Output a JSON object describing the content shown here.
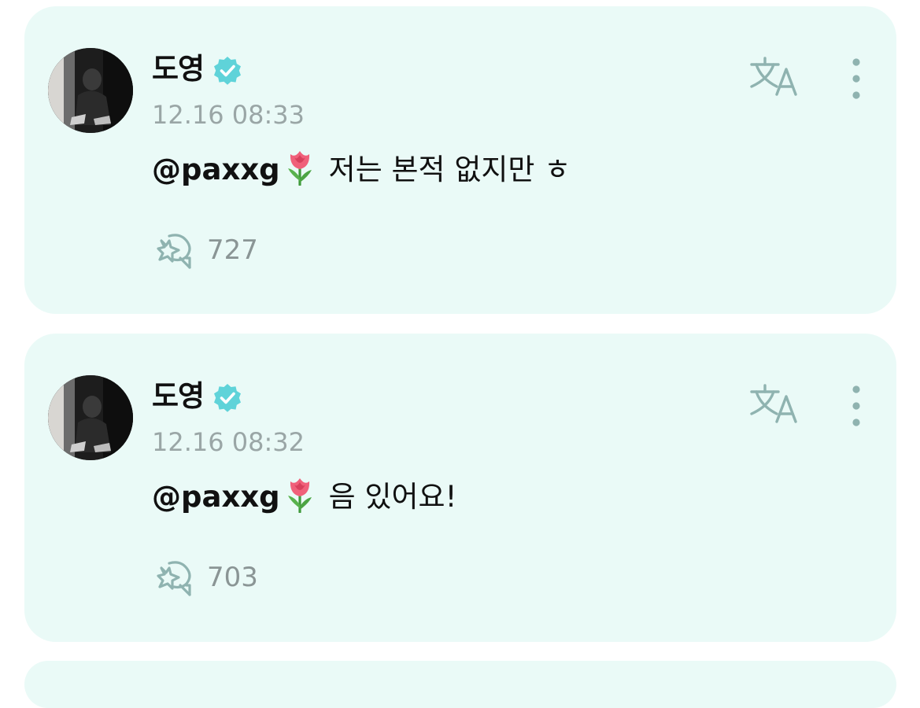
{
  "comments": [
    {
      "author": "도영",
      "timestamp": "12.16 08:33",
      "mention": "@paxxg",
      "text": "저는 본적 없지만 ㅎ",
      "like_count": "727"
    },
    {
      "author": "도영",
      "timestamp": "12.16 08:32",
      "mention": "@paxxg",
      "text": "음 있어요!",
      "like_count": "703"
    }
  ],
  "icons": {
    "verified": "verified-badge-icon",
    "translate": "translate-icon",
    "more": "more-vertical-icon",
    "like": "heart-sticker-icon",
    "emoji": "tulip-emoji"
  },
  "colors": {
    "card_background": "#eafaf7",
    "verified": "#5fd3d9",
    "timestamp": "#9aa6a6",
    "icon": "#8fb3b0"
  }
}
